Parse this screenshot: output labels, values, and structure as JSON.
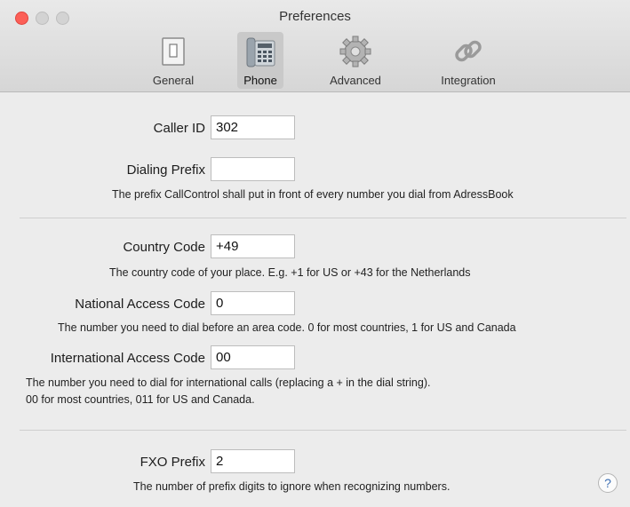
{
  "window": {
    "title": "Preferences"
  },
  "tabs": [
    {
      "label": "General",
      "icon": "switch-icon"
    },
    {
      "label": "Phone",
      "icon": "phone-icon",
      "selected": true
    },
    {
      "label": "Advanced",
      "icon": "gear-icon"
    },
    {
      "label": "Integration",
      "icon": "link-icon"
    }
  ],
  "form": {
    "caller_id": {
      "label": "Caller ID",
      "value": "302"
    },
    "dialing_prefix": {
      "label": "Dialing Prefix",
      "value": "",
      "help": "The prefix CallControl shall put in front of every number you dial from AdressBook"
    },
    "country_code": {
      "label": "Country Code",
      "value": "+49",
      "help": "The country code of your place. E.g. +1 for US or +43 for the Netherlands"
    },
    "national_access_code": {
      "label": "National Access Code",
      "value": "0",
      "help": "The number you need to dial before an area code. 0 for most countries, 1 for US and Canada"
    },
    "international_access_code": {
      "label": "International Access Code",
      "value": "00",
      "help_line1": "The number you need to dial for international calls (replacing a + in the dial string).",
      "help_line2": "00 for most countries, 011 for US and Canada."
    },
    "fxo_prefix": {
      "label": "FXO Prefix",
      "value": "2",
      "help": "The number of prefix digits to ignore when recognizing numbers."
    }
  },
  "help_button": {
    "label": "?"
  },
  "colors": {
    "close": "#fc5f57",
    "accent": "#3d6fb4"
  }
}
